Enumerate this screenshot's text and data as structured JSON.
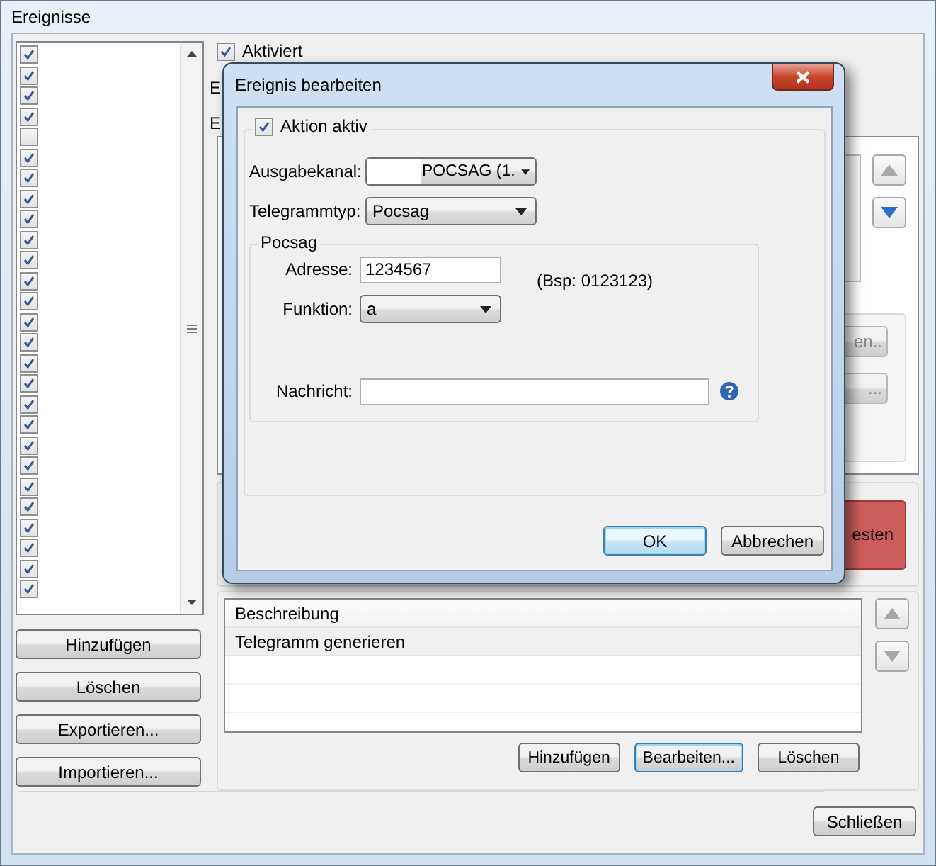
{
  "window": {
    "title": "Ereignisse"
  },
  "event_list": {
    "items": [
      {
        "checked": true
      },
      {
        "checked": true
      },
      {
        "checked": true
      },
      {
        "checked": true
      },
      {
        "checked": false
      },
      {
        "checked": true
      },
      {
        "checked": true
      },
      {
        "checked": true
      },
      {
        "checked": true
      },
      {
        "checked": true
      },
      {
        "checked": true
      },
      {
        "checked": true
      },
      {
        "checked": true
      },
      {
        "checked": true
      },
      {
        "checked": true
      },
      {
        "checked": true
      },
      {
        "checked": true
      },
      {
        "checked": true
      },
      {
        "checked": true
      },
      {
        "checked": true
      },
      {
        "checked": true
      },
      {
        "checked": true
      },
      {
        "checked": true
      },
      {
        "checked": true
      },
      {
        "checked": true
      },
      {
        "checked": true
      },
      {
        "checked": true
      }
    ]
  },
  "left_buttons": [
    "Hinzufügen",
    "Löschen",
    "Exportieren...",
    "Importieren..."
  ],
  "details": {
    "activated": {
      "label": "Aktiviert",
      "checked": true
    },
    "labels": [
      "E",
      "E"
    ],
    "side_buttons": [
      "en..",
      "..."
    ],
    "test_button": "esten"
  },
  "actions": {
    "columns": [
      "Beschreibung"
    ],
    "rows": [
      "Telegramm generieren"
    ],
    "buttons": [
      "Hinzufügen",
      "Bearbeiten...",
      "Löschen"
    ]
  },
  "footer": {
    "close_button": "Schließen"
  },
  "dialog": {
    "title": "Ereignis bearbeiten",
    "action_active": {
      "label": "Aktion aktiv",
      "checked": true
    },
    "output_channel": {
      "label": "Ausgabekanal:",
      "value": "POCSAG (1."
    },
    "telegram_type": {
      "label": "Telegrammtyp:",
      "value": "Pocsag"
    },
    "pocsag": {
      "title": "Pocsag",
      "address": {
        "label": "Adresse:",
        "value": "1234567"
      },
      "address_hint": "(Bsp: 0123123)",
      "function": {
        "label": "Funktion:",
        "value": "a"
      },
      "message": {
        "label": "Nachricht:"
      }
    },
    "buttons": [
      "OK",
      "Abbrechen"
    ]
  }
}
